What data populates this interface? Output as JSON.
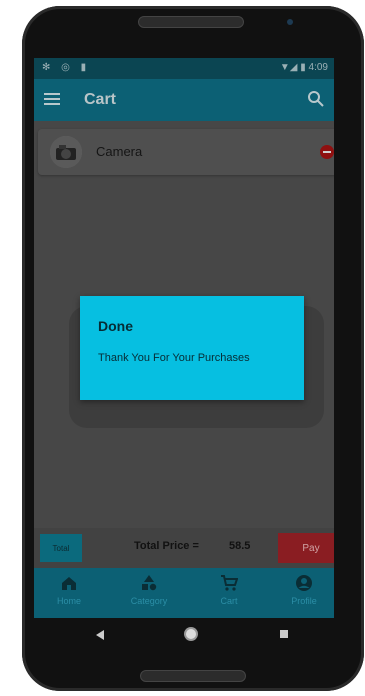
{
  "app": {
    "title": "Cart",
    "time": "4:09"
  },
  "cart": {
    "items": [
      {
        "name": "Camera"
      }
    ]
  },
  "dialog": {
    "title": "Done",
    "message": "Thank You For Your Purchases"
  },
  "summary": {
    "total_button": "Total",
    "total_label": "Total Price =",
    "total_value": "58.5",
    "pay_button": "Pay"
  },
  "bottom_nav": [
    {
      "label": "Home",
      "icon": "home-icon"
    },
    {
      "label": "Category",
      "icon": "category-icon"
    },
    {
      "label": "Cart",
      "icon": "cart-icon"
    },
    {
      "label": "Profile",
      "icon": "profile-icon"
    }
  ],
  "colors": {
    "accent": "#06bfe1",
    "appbar": "#0c6074",
    "pay": "#8a1d22",
    "total": "#0b6a7d"
  }
}
